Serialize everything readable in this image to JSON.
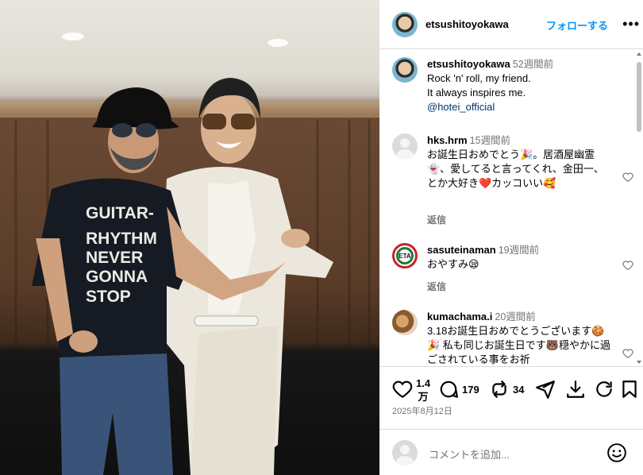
{
  "post": {
    "author": "etsushitoyokawa",
    "follow_label": "フォローする",
    "more_label": "•••"
  },
  "caption": {
    "author": "etsushitoyokawa",
    "time": "52週間前",
    "line1": "Rock 'n' roll, my friend.",
    "line2": "It always inspires me.",
    "mention": "@hotei_official"
  },
  "shirt_text": [
    "GUITAR-",
    "RHYTHM",
    "NEVER",
    "GONNA",
    "STOP"
  ],
  "comments": [
    {
      "user": "hks.hrm",
      "time": "15週間前",
      "text": "お誕生日おめでとう🎉。居酒屋幽霊👻、愛してると言ってくれ、金田一、とか大好き❤️カッコいい🥰",
      "reply": "返信"
    },
    {
      "user": "sasuteinaman",
      "time": "19週間前",
      "text": "おやすみ😪",
      "reply": "返信",
      "avatar_text": "ETA"
    },
    {
      "user": "kumachama.i",
      "time": "20週間前",
      "text": "3.18お誕生日おめでとうございます🍪🎉 私も同じお誕生日です🐻穏やかに過ごされている事をお祈",
      "reply": ""
    }
  ],
  "stats": {
    "likes": "1.4万",
    "likes_line1": "1.4",
    "likes_line2": "万",
    "comments": "179",
    "reposts": "34",
    "date": "2025年8月12日"
  },
  "compose": {
    "placeholder": "コメントを追加..."
  },
  "colors": {
    "accent": "#0095f6",
    "muted": "#737373",
    "border": "#dbdbdb",
    "mention": "#00376b"
  },
  "icons": [
    "heart-icon",
    "comment-icon",
    "repost-icon",
    "share-icon",
    "download-icon",
    "refresh-icon",
    "bookmark-icon",
    "emoji-icon"
  ]
}
